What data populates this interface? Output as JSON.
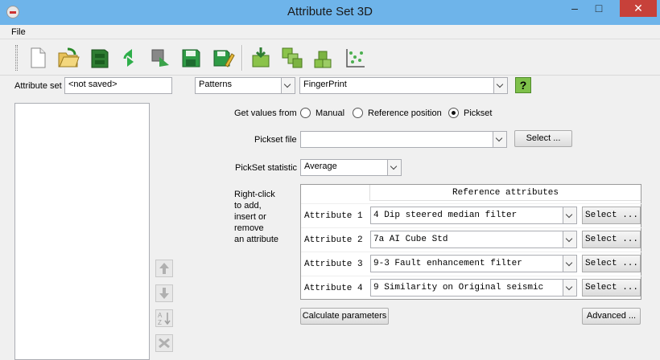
{
  "window": {
    "title": "Attribute Set 3D",
    "min": "–",
    "max": "□",
    "close": "✕"
  },
  "menu": {
    "file": "File"
  },
  "toolbar": {
    "icons": [
      "new-icon",
      "open-icon",
      "save-cabinet-icon",
      "reload-icon",
      "import-icon",
      "save-icon",
      "save-as-icon",
      "get-from-icon",
      "link-icon",
      "stack-icon",
      "scatter-icon"
    ]
  },
  "attribute_set": {
    "label": "Attribute set",
    "value": "<not saved>"
  },
  "category_combo": {
    "value": "Patterns"
  },
  "method_combo": {
    "value": "FingerPrint"
  },
  "help": {
    "label": "?"
  },
  "get_values": {
    "label": "Get values from",
    "options": [
      "Manual",
      "Reference position",
      "Pickset"
    ],
    "selected": "Pickset"
  },
  "pickset_file": {
    "label": "Pickset file",
    "value": "",
    "button": "Select ..."
  },
  "pickset_statistic": {
    "label": "PickSet statistic",
    "value": "Average"
  },
  "instructions": {
    "lines": [
      "Right-click",
      "to add,",
      "insert or",
      "remove",
      "an attribute"
    ]
  },
  "table": {
    "header": "Reference attributes",
    "rows": [
      {
        "label": "Attribute 1",
        "value": "4 Dip steered median filter",
        "button": "Select ..."
      },
      {
        "label": "Attribute 2",
        "value": "7a AI Cube Std",
        "button": "Select ..."
      },
      {
        "label": "Attribute 3",
        "value": "9-3 Fault enhancement filter",
        "button": "Select ..."
      },
      {
        "label": "Attribute 4",
        "value": "9 Similarity on Original seismic",
        "button": "Select ..."
      }
    ]
  },
  "buttons": {
    "calculate": "Calculate parameters",
    "advanced": "Advanced ..."
  },
  "sort": {
    "label_top": "A",
    "label_bottom": "Z"
  }
}
